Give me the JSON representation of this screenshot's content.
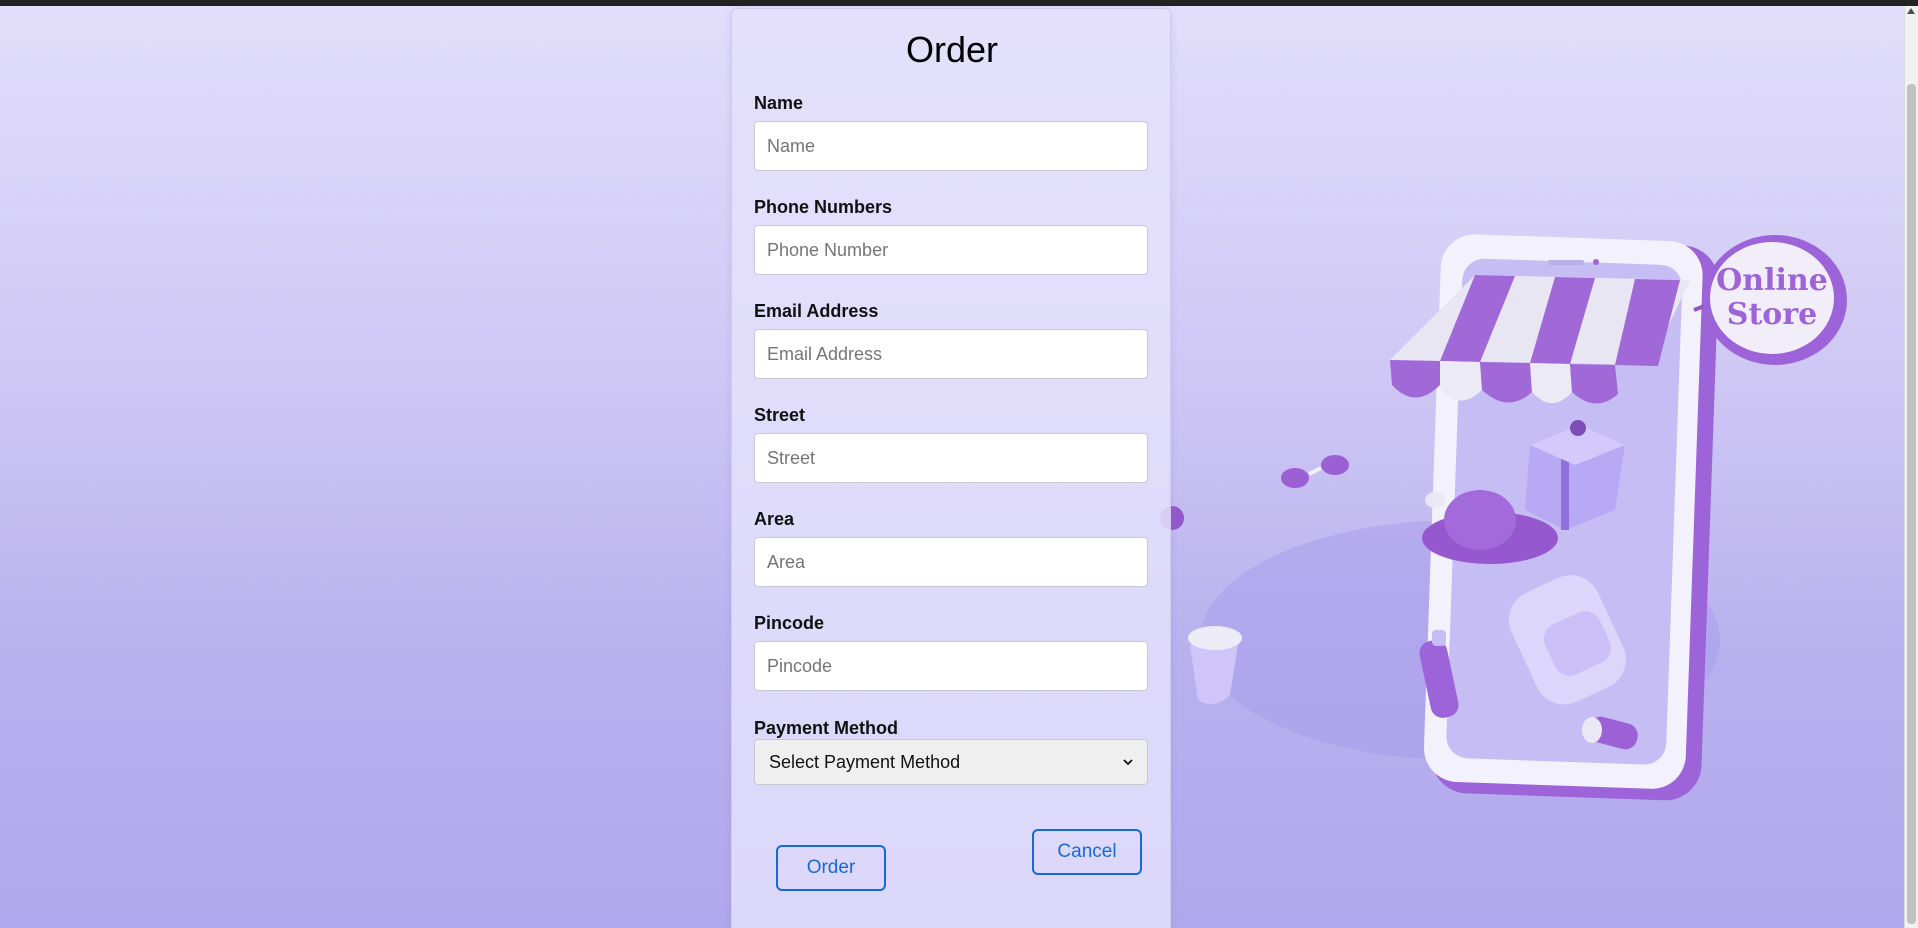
{
  "form": {
    "title": "Order",
    "fields": [
      {
        "label": "Name",
        "placeholder": "Name",
        "value": ""
      },
      {
        "label": "Phone Numbers",
        "placeholder": "Phone Number",
        "value": ""
      },
      {
        "label": "Email Address",
        "placeholder": "Email Address",
        "value": ""
      },
      {
        "label": "Street",
        "placeholder": "Street",
        "value": ""
      },
      {
        "label": "Area",
        "placeholder": "Area",
        "value": ""
      },
      {
        "label": "Pincode",
        "placeholder": "Pincode",
        "value": ""
      }
    ],
    "payment": {
      "label": "Payment Method",
      "selected": "Select Payment Method"
    },
    "order_button": "Order",
    "cancel_button": "Cancel"
  },
  "illustration": {
    "sign_line1": "Online",
    "sign_line2": "Store"
  },
  "colors": {
    "accent": "#1769d6",
    "brand_purple": "#9b5fd6",
    "background": "#cfc8f5"
  }
}
